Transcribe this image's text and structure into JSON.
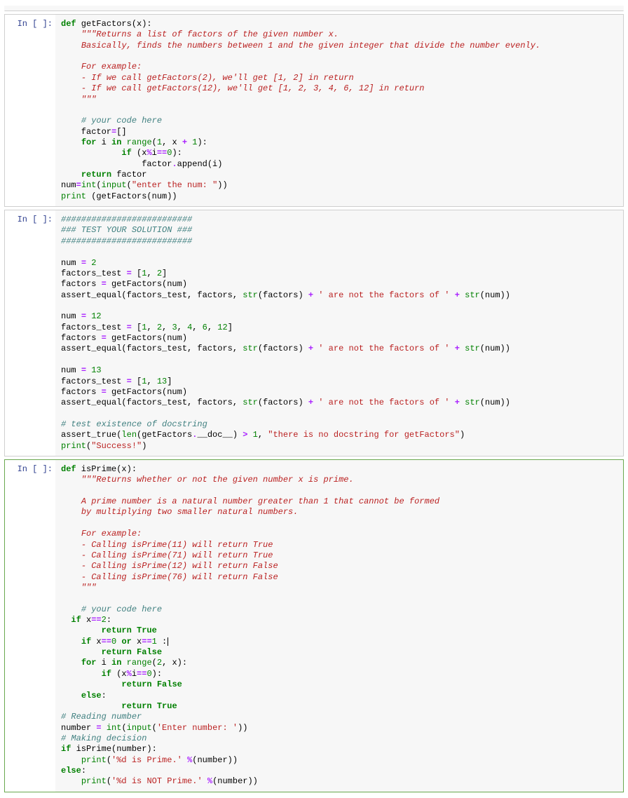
{
  "prompt_label": "In [ ]:",
  "cells": [
    {
      "id": "cell-getfactors",
      "tokens": [
        [
          "kw",
          "def"
        ],
        [
          "nm",
          " getFactors(x):"
        ],
        [
          "nl",
          ""
        ],
        [
          "nm",
          "    "
        ],
        [
          "doc",
          "\"\"\"Returns a list of factors of the given number x."
        ],
        [
          "nl",
          ""
        ],
        [
          "nm",
          "    "
        ],
        [
          "doc",
          "Basically, finds the numbers between 1 and the given integer that divide the number evenly."
        ],
        [
          "nl",
          ""
        ],
        [
          "nl",
          ""
        ],
        [
          "nm",
          "    "
        ],
        [
          "doc",
          "For example:"
        ],
        [
          "nl",
          ""
        ],
        [
          "nm",
          "    "
        ],
        [
          "doc",
          "- If we call getFactors(2), we'll get [1, 2] in return"
        ],
        [
          "nl",
          ""
        ],
        [
          "nm",
          "    "
        ],
        [
          "doc",
          "- If we call getFactors(12), we'll get [1, 2, 3, 4, 6, 12] in return"
        ],
        [
          "nl",
          ""
        ],
        [
          "nm",
          "    "
        ],
        [
          "doc",
          "\"\"\""
        ],
        [
          "nl",
          ""
        ],
        [
          "nl",
          ""
        ],
        [
          "nm",
          "    "
        ],
        [
          "cmt",
          "# your code here"
        ],
        [
          "nl",
          ""
        ],
        [
          "nm",
          "    factor"
        ],
        [
          "op",
          "="
        ],
        [
          "nm",
          "[]"
        ],
        [
          "nl",
          ""
        ],
        [
          "nm",
          "    "
        ],
        [
          "kw",
          "for"
        ],
        [
          "nm",
          " i "
        ],
        [
          "kw",
          "in"
        ],
        [
          "nm",
          " "
        ],
        [
          "bi",
          "range"
        ],
        [
          "nm",
          "("
        ],
        [
          "num",
          "1"
        ],
        [
          "nm",
          ", x "
        ],
        [
          "op",
          "+"
        ],
        [
          "nm",
          " "
        ],
        [
          "num",
          "1"
        ],
        [
          "nm",
          "):"
        ],
        [
          "nl",
          ""
        ],
        [
          "nm",
          "            "
        ],
        [
          "kw",
          "if"
        ],
        [
          "nm",
          " (x"
        ],
        [
          "op",
          "%"
        ],
        [
          "nm",
          "i"
        ],
        [
          "op",
          "=="
        ],
        [
          "num",
          "0"
        ],
        [
          "nm",
          "):"
        ],
        [
          "nl",
          ""
        ],
        [
          "nm",
          "                factor"
        ],
        [
          "op",
          "."
        ],
        [
          "nm",
          "append(i)"
        ],
        [
          "nl",
          ""
        ],
        [
          "nm",
          "    "
        ],
        [
          "kw",
          "return"
        ],
        [
          "nm",
          " factor"
        ],
        [
          "nl",
          ""
        ],
        [
          "nm",
          "num"
        ],
        [
          "op",
          "="
        ],
        [
          "bi",
          "int"
        ],
        [
          "nm",
          "("
        ],
        [
          "bi",
          "input"
        ],
        [
          "nm",
          "("
        ],
        [
          "str",
          "\"enter the num: \""
        ],
        [
          "nm",
          "))"
        ],
        [
          "nl",
          ""
        ],
        [
          "bi",
          "print"
        ],
        [
          "nm",
          " (getFactors(num))"
        ]
      ]
    },
    {
      "id": "cell-tests",
      "tokens": [
        [
          "cmt",
          "##########################"
        ],
        [
          "nl",
          ""
        ],
        [
          "cmt",
          "### TEST YOUR SOLUTION ###"
        ],
        [
          "nl",
          ""
        ],
        [
          "cmt",
          "##########################"
        ],
        [
          "nl",
          ""
        ],
        [
          "nl",
          ""
        ],
        [
          "nm",
          "num "
        ],
        [
          "op",
          "="
        ],
        [
          "nm",
          " "
        ],
        [
          "num",
          "2"
        ],
        [
          "nl",
          ""
        ],
        [
          "nm",
          "factors_test "
        ],
        [
          "op",
          "="
        ],
        [
          "nm",
          " ["
        ],
        [
          "num",
          "1"
        ],
        [
          "nm",
          ", "
        ],
        [
          "num",
          "2"
        ],
        [
          "nm",
          "]"
        ],
        [
          "nl",
          ""
        ],
        [
          "nm",
          "factors "
        ],
        [
          "op",
          "="
        ],
        [
          "nm",
          " getFactors(num)"
        ],
        [
          "nl",
          ""
        ],
        [
          "nm",
          "assert_equal(factors_test, factors, "
        ],
        [
          "bi",
          "str"
        ],
        [
          "nm",
          "(factors) "
        ],
        [
          "op",
          "+"
        ],
        [
          "nm",
          " "
        ],
        [
          "str",
          "' are not the factors of '"
        ],
        [
          "nm",
          " "
        ],
        [
          "op",
          "+"
        ],
        [
          "nm",
          " "
        ],
        [
          "bi",
          "str"
        ],
        [
          "nm",
          "(num))"
        ],
        [
          "nl",
          ""
        ],
        [
          "nl",
          ""
        ],
        [
          "nm",
          "num "
        ],
        [
          "op",
          "="
        ],
        [
          "nm",
          " "
        ],
        [
          "num",
          "12"
        ],
        [
          "nl",
          ""
        ],
        [
          "nm",
          "factors_test "
        ],
        [
          "op",
          "="
        ],
        [
          "nm",
          " ["
        ],
        [
          "num",
          "1"
        ],
        [
          "nm",
          ", "
        ],
        [
          "num",
          "2"
        ],
        [
          "nm",
          ", "
        ],
        [
          "num",
          "3"
        ],
        [
          "nm",
          ", "
        ],
        [
          "num",
          "4"
        ],
        [
          "nm",
          ", "
        ],
        [
          "num",
          "6"
        ],
        [
          "nm",
          ", "
        ],
        [
          "num",
          "12"
        ],
        [
          "nm",
          "]"
        ],
        [
          "nl",
          ""
        ],
        [
          "nm",
          "factors "
        ],
        [
          "op",
          "="
        ],
        [
          "nm",
          " getFactors(num)"
        ],
        [
          "nl",
          ""
        ],
        [
          "nm",
          "assert_equal(factors_test, factors, "
        ],
        [
          "bi",
          "str"
        ],
        [
          "nm",
          "(factors) "
        ],
        [
          "op",
          "+"
        ],
        [
          "nm",
          " "
        ],
        [
          "str",
          "' are not the factors of '"
        ],
        [
          "nm",
          " "
        ],
        [
          "op",
          "+"
        ],
        [
          "nm",
          " "
        ],
        [
          "bi",
          "str"
        ],
        [
          "nm",
          "(num))"
        ],
        [
          "nl",
          ""
        ],
        [
          "nl",
          ""
        ],
        [
          "nm",
          "num "
        ],
        [
          "op",
          "="
        ],
        [
          "nm",
          " "
        ],
        [
          "num",
          "13"
        ],
        [
          "nl",
          ""
        ],
        [
          "nm",
          "factors_test "
        ],
        [
          "op",
          "="
        ],
        [
          "nm",
          " ["
        ],
        [
          "num",
          "1"
        ],
        [
          "nm",
          ", "
        ],
        [
          "num",
          "13"
        ],
        [
          "nm",
          "]"
        ],
        [
          "nl",
          ""
        ],
        [
          "nm",
          "factors "
        ],
        [
          "op",
          "="
        ],
        [
          "nm",
          " getFactors(num)"
        ],
        [
          "nl",
          ""
        ],
        [
          "nm",
          "assert_equal(factors_test, factors, "
        ],
        [
          "bi",
          "str"
        ],
        [
          "nm",
          "(factors) "
        ],
        [
          "op",
          "+"
        ],
        [
          "nm",
          " "
        ],
        [
          "str",
          "' are not the factors of '"
        ],
        [
          "nm",
          " "
        ],
        [
          "op",
          "+"
        ],
        [
          "nm",
          " "
        ],
        [
          "bi",
          "str"
        ],
        [
          "nm",
          "(num))"
        ],
        [
          "nl",
          ""
        ],
        [
          "nl",
          ""
        ],
        [
          "cmt",
          "# test existence of docstring"
        ],
        [
          "nl",
          ""
        ],
        [
          "nm",
          "assert_true("
        ],
        [
          "bi",
          "len"
        ],
        [
          "nm",
          "(getFactors"
        ],
        [
          "op",
          "."
        ],
        [
          "nm",
          "__doc__) "
        ],
        [
          "op",
          ">"
        ],
        [
          "nm",
          " "
        ],
        [
          "num",
          "1"
        ],
        [
          "nm",
          ", "
        ],
        [
          "str",
          "\"there is no docstring for getFactors\""
        ],
        [
          "nm",
          ")"
        ],
        [
          "nl",
          ""
        ],
        [
          "bi",
          "print"
        ],
        [
          "nm",
          "("
        ],
        [
          "str",
          "\"Success!\""
        ],
        [
          "nm",
          ")"
        ]
      ]
    },
    {
      "id": "cell-isprime",
      "selected": true,
      "tokens": [
        [
          "kw",
          "def"
        ],
        [
          "nm",
          " isPrime(x):"
        ],
        [
          "nl",
          ""
        ],
        [
          "nm",
          "    "
        ],
        [
          "doc",
          "\"\"\"Returns whether or not the given number x is prime."
        ],
        [
          "nl",
          ""
        ],
        [
          "nl",
          ""
        ],
        [
          "nm",
          "    "
        ],
        [
          "doc",
          "A prime number is a natural number greater than 1 that cannot be formed"
        ],
        [
          "nl",
          ""
        ],
        [
          "nm",
          "    "
        ],
        [
          "doc",
          "by multiplying two smaller natural numbers."
        ],
        [
          "nl",
          ""
        ],
        [
          "nl",
          ""
        ],
        [
          "nm",
          "    "
        ],
        [
          "doc",
          "For example:"
        ],
        [
          "nl",
          ""
        ],
        [
          "nm",
          "    "
        ],
        [
          "doc",
          "- Calling isPrime(11) will return True"
        ],
        [
          "nl",
          ""
        ],
        [
          "nm",
          "    "
        ],
        [
          "doc",
          "- Calling isPrime(71) will return True"
        ],
        [
          "nl",
          ""
        ],
        [
          "nm",
          "    "
        ],
        [
          "doc",
          "- Calling isPrime(12) will return False"
        ],
        [
          "nl",
          ""
        ],
        [
          "nm",
          "    "
        ],
        [
          "doc",
          "- Calling isPrime(76) will return False"
        ],
        [
          "nl",
          ""
        ],
        [
          "nm",
          "    "
        ],
        [
          "doc",
          "\"\"\""
        ],
        [
          "nl",
          ""
        ],
        [
          "nl",
          ""
        ],
        [
          "nm",
          "    "
        ],
        [
          "cmt",
          "# your code here"
        ],
        [
          "nl",
          ""
        ],
        [
          "nm",
          "  "
        ],
        [
          "kw",
          "if"
        ],
        [
          "nm",
          " x"
        ],
        [
          "op",
          "=="
        ],
        [
          "num",
          "2"
        ],
        [
          "nm",
          ":"
        ],
        [
          "nl",
          ""
        ],
        [
          "nm",
          "        "
        ],
        [
          "kw",
          "return"
        ],
        [
          "nm",
          " "
        ],
        [
          "kw",
          "True"
        ],
        [
          "nl",
          ""
        ],
        [
          "nm",
          "    "
        ],
        [
          "kw",
          "if"
        ],
        [
          "nm",
          " x"
        ],
        [
          "op",
          "=="
        ],
        [
          "num",
          "0"
        ],
        [
          "nm",
          " "
        ],
        [
          "kw",
          "or"
        ],
        [
          "nm",
          " x"
        ],
        [
          "op",
          "=="
        ],
        [
          "num",
          "1"
        ],
        [
          "nm",
          " :"
        ],
        [
          "cursor",
          ""
        ],
        [
          "nl",
          ""
        ],
        [
          "nm",
          "        "
        ],
        [
          "kw",
          "return"
        ],
        [
          "nm",
          " "
        ],
        [
          "kw",
          "False"
        ],
        [
          "nl",
          ""
        ],
        [
          "nm",
          "    "
        ],
        [
          "kw",
          "for"
        ],
        [
          "nm",
          " i "
        ],
        [
          "kw",
          "in"
        ],
        [
          "nm",
          " "
        ],
        [
          "bi",
          "range"
        ],
        [
          "nm",
          "("
        ],
        [
          "num",
          "2"
        ],
        [
          "nm",
          ", x):"
        ],
        [
          "nl",
          ""
        ],
        [
          "nm",
          "        "
        ],
        [
          "kw",
          "if"
        ],
        [
          "nm",
          " (x"
        ],
        [
          "op",
          "%"
        ],
        [
          "nm",
          "i"
        ],
        [
          "op",
          "=="
        ],
        [
          "num",
          "0"
        ],
        [
          "nm",
          "):"
        ],
        [
          "nl",
          ""
        ],
        [
          "nm",
          "            "
        ],
        [
          "kw",
          "return"
        ],
        [
          "nm",
          " "
        ],
        [
          "kw",
          "False"
        ],
        [
          "nl",
          ""
        ],
        [
          "nm",
          "    "
        ],
        [
          "kw",
          "else"
        ],
        [
          "nm",
          ":"
        ],
        [
          "nl",
          ""
        ],
        [
          "nm",
          "            "
        ],
        [
          "kw",
          "return"
        ],
        [
          "nm",
          " "
        ],
        [
          "kw",
          "True"
        ],
        [
          "nl",
          ""
        ],
        [
          "cmt",
          "# Reading number"
        ],
        [
          "nl",
          ""
        ],
        [
          "nm",
          "number "
        ],
        [
          "op",
          "="
        ],
        [
          "nm",
          " "
        ],
        [
          "bi",
          "int"
        ],
        [
          "nm",
          "("
        ],
        [
          "bi",
          "input"
        ],
        [
          "nm",
          "("
        ],
        [
          "str",
          "'Enter number: '"
        ],
        [
          "nm",
          "))"
        ],
        [
          "nl",
          ""
        ],
        [
          "cmt",
          "# Making decision"
        ],
        [
          "nl",
          ""
        ],
        [
          "kw",
          "if"
        ],
        [
          "nm",
          " isPrime(number):"
        ],
        [
          "nl",
          ""
        ],
        [
          "nm",
          "    "
        ],
        [
          "bi",
          "print"
        ],
        [
          "nm",
          "("
        ],
        [
          "str",
          "'%d is Prime.'"
        ],
        [
          "nm",
          " "
        ],
        [
          "op",
          "%"
        ],
        [
          "nm",
          "(number))"
        ],
        [
          "nl",
          ""
        ],
        [
          "kw",
          "else"
        ],
        [
          "nm",
          ":"
        ],
        [
          "nl",
          ""
        ],
        [
          "nm",
          "    "
        ],
        [
          "bi",
          "print"
        ],
        [
          "nm",
          "("
        ],
        [
          "str",
          "'%d is NOT Prime.'"
        ],
        [
          "nm",
          " "
        ],
        [
          "op",
          "%"
        ],
        [
          "nm",
          "(number))"
        ]
      ]
    }
  ]
}
